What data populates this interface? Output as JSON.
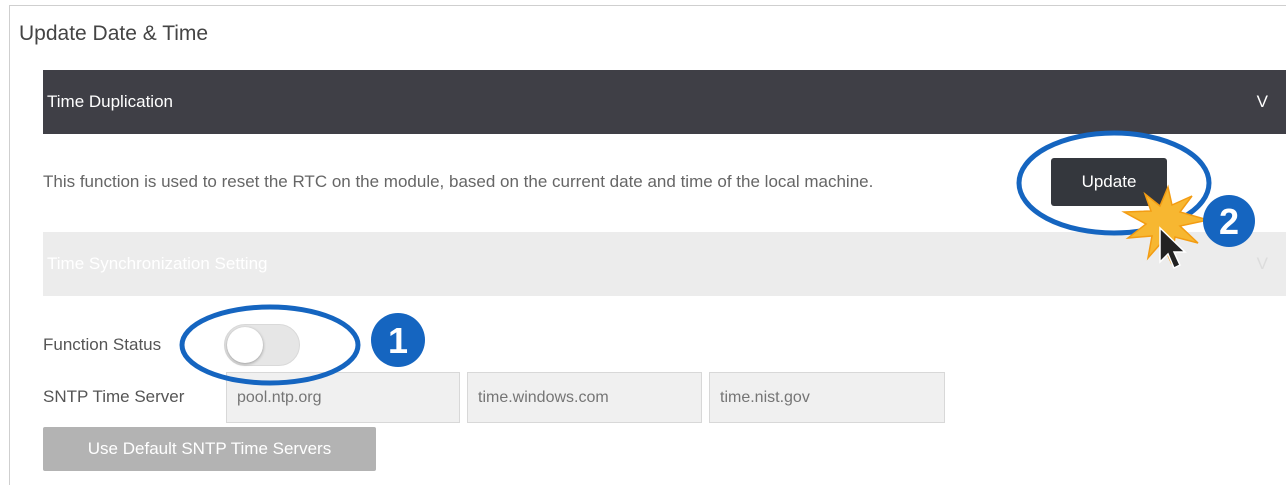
{
  "panel": {
    "title": "Update Date & Time"
  },
  "time_duplication": {
    "title": "Time Duplication",
    "chevron": "V",
    "description": "This function is used to reset the RTC on the module, based on the current date and time of the local machine.",
    "update_label": "Update"
  },
  "time_sync": {
    "title": "Time Synchronization Setting",
    "chevron": "V",
    "function_status_label": "Function Status",
    "function_status_on": false,
    "sntp_label": "SNTP Time Server",
    "servers": [
      {
        "placeholder": "pool.ntp.org"
      },
      {
        "placeholder": "time.windows.com"
      },
      {
        "placeholder": "time.nist.gov"
      }
    ],
    "default_button_label": "Use Default SNTP Time Servers"
  },
  "annotations": {
    "step_1": "1",
    "step_2": "2",
    "highlight_color": "#1565c0",
    "burst_color": "#f7b731"
  }
}
